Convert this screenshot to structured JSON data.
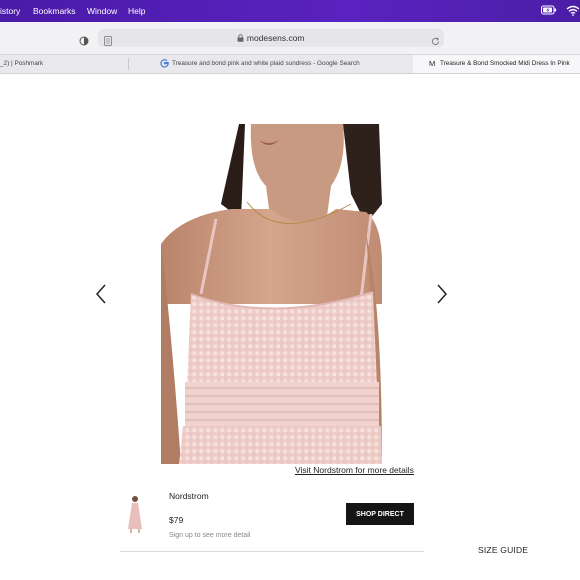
{
  "menubar": {
    "items": [
      "istory",
      "Bookmarks",
      "Window",
      "Help"
    ]
  },
  "browser": {
    "url": "modesens.com",
    "tabs": [
      {
        "title": "_2) | Poshmark"
      },
      {
        "title": "Treasure and bond pink and white plaid sundress - Google Search",
        "icon": "google-icon"
      },
      {
        "title": "Treasure & Bond Smocked Midi Dress In Pink",
        "icon": "modesens-m-icon"
      }
    ]
  },
  "product": {
    "visit_link": "Visit Nordstrom for more details",
    "store": "Nordstrom",
    "price": "$79",
    "signup_note": "Sign up to see more detail",
    "shop_button": "SHOP DIRECT",
    "size_guide": "SIZE GUIDE"
  },
  "colors": {
    "menubar": "#4f1db3",
    "dress_pink": "#ecc6c4",
    "button": "#151515"
  }
}
